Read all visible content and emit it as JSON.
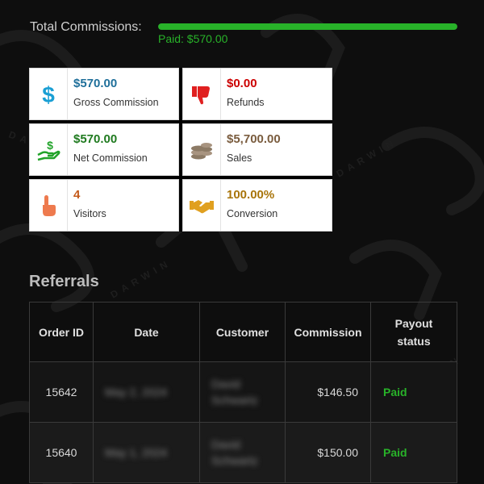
{
  "colors": {
    "background": "#0e0e0e",
    "accent_green": "#28b229",
    "blue_value": "#1f6f9a",
    "red_value": "#cc0000",
    "green_value": "#1f7a1f",
    "brown_value": "#7a5c3e",
    "orange_value": "#c45a1a",
    "gold_value": "#a8740a"
  },
  "total": {
    "label": "Total Commissions:",
    "paid_text": "Paid: $570.00",
    "progress_percent": 100
  },
  "stats": [
    {
      "value": "$570.00",
      "label": "Gross Commission",
      "icon": "dollar-icon",
      "color": "#1f6f9a"
    },
    {
      "value": "$0.00",
      "label": "Refunds",
      "icon": "thumbs-down-icon",
      "color": "#cc0000"
    },
    {
      "value": "$570.00",
      "label": "Net Commission",
      "icon": "money-hand-icon",
      "color": "#1f7a1f"
    },
    {
      "value": "$5,700.00",
      "label": "Sales",
      "icon": "coins-icon",
      "color": "#7a5c3e"
    },
    {
      "value": "4",
      "label": "Visitors",
      "icon": "pointing-hand-icon",
      "color": "#c45a1a"
    },
    {
      "value": "100.00%",
      "label": "Conversion",
      "icon": "handshake-icon",
      "color": "#a8740a"
    }
  ],
  "referrals": {
    "title": "Referrals",
    "columns": [
      "Order ID",
      "Date",
      "Customer",
      "Commission",
      "Payout status"
    ],
    "rows": [
      {
        "order_id": "15642",
        "date": "May 2, 2024",
        "customer": "David Schwartz",
        "commission": "$146.50",
        "status": "Paid"
      },
      {
        "order_id": "15640",
        "date": "May 1, 2024",
        "customer": "David Schwartz",
        "commission": "$150.00",
        "status": "Paid"
      }
    ]
  }
}
